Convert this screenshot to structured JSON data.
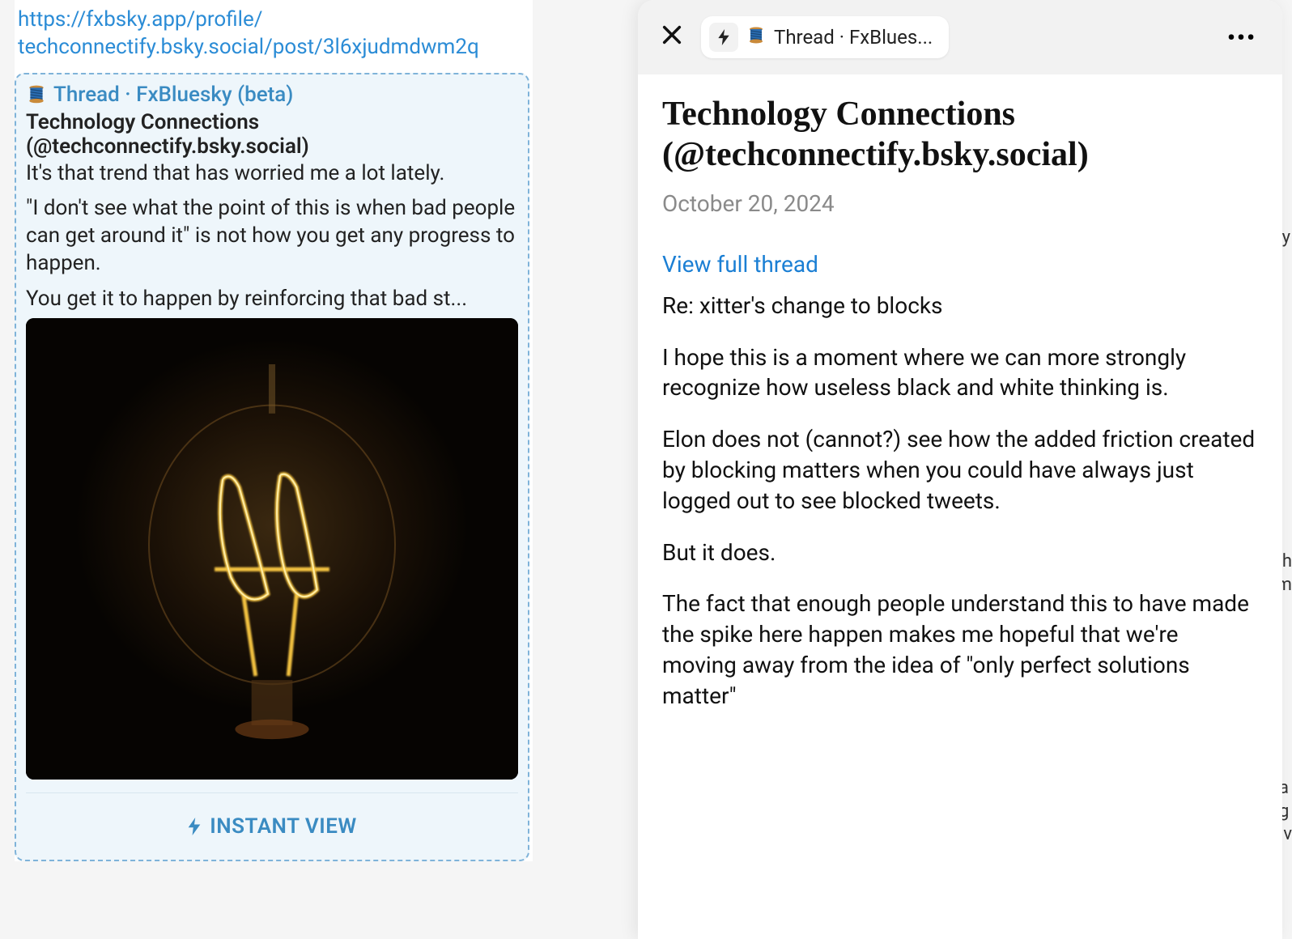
{
  "left": {
    "url": "https://fxbsky.app/profile/\ntechconnectify.bsky.social/post/3l6xjudmdwm2q",
    "thread_label": "Thread · FxBluesky (beta)",
    "author_name": "Technology Connections",
    "author_handle": "(@techconnectify.bsky.social)",
    "body_line1": "It's that trend that has worried me a lot lately.",
    "body_line2": "\"I don't see what the point of this is when bad people can get around it\" is not how you get any progress to happen.",
    "body_line3": "You get it to happen by reinforcing that bad st...",
    "instant_view_label": "INSTANT VIEW",
    "image_alt": "lightbulb-photo"
  },
  "right": {
    "tab_title": "Thread · FxBlues...",
    "article_title": "Technology Connections (@techconnectify.bsky.social)",
    "date": "October 20, 2024",
    "view_thread": "View full thread",
    "paragraphs": [
      "Re: xitter's change to blocks",
      "I hope this is a moment where we can more strongly recognize how useless black and white thinking is.",
      "Elon does not (cannot?) see how the added friction created by blocking matters when you could have always just logged out to see blocked tweets.",
      "But it does.",
      "The fact that enough people understand this to have made the spike here happen makes me hopeful that we're moving away from the idea of \"only perfect solutions matter\""
    ]
  },
  "edge": {
    "frag1": "y",
    "frag2": "th\nm",
    "frag3": "a\ng\niv"
  }
}
